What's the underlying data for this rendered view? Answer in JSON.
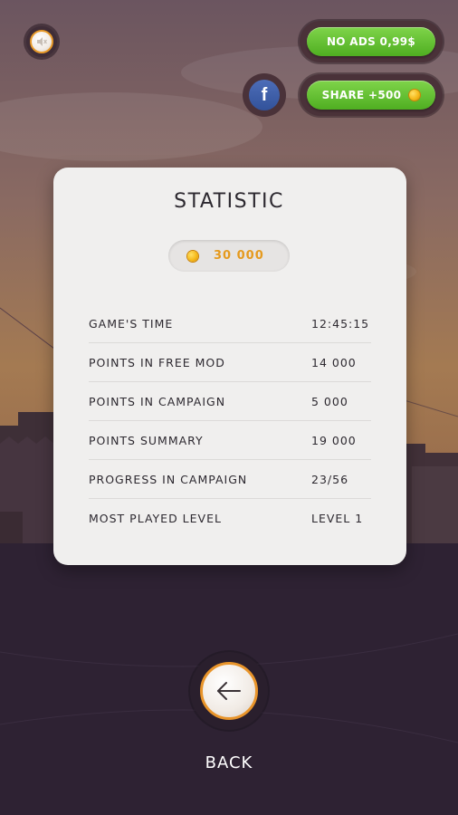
{
  "header": {
    "no_ads_label": "NO ADS 0,99$",
    "share_label": "SHARE +500",
    "facebook_glyph": "f"
  },
  "statistic": {
    "title": "STATISTIC",
    "coins": "30 000",
    "rows": [
      {
        "label": "GAME'S TIME",
        "value": "12:45:15"
      },
      {
        "label": "POINTS IN FREE MOD",
        "value": "14 000"
      },
      {
        "label": "POINTS IN CAMPAIGN",
        "value": "5 000"
      },
      {
        "label": "POINTS SUMMARY",
        "value": "19 000"
      },
      {
        "label": "PROGRESS IN CAMPAIGN",
        "value": "23/56"
      },
      {
        "label": "MOST PLAYED LEVEL",
        "value": "LEVEL 1"
      }
    ]
  },
  "footer": {
    "back_label": "BACK"
  },
  "colors": {
    "accent_orange": "#e59a1e",
    "button_green": "#5cba2a",
    "card_bg": "#f0efee",
    "facebook_blue": "#3b5ba5"
  },
  "icons": {
    "mute": "speaker-muted-icon",
    "facebook": "facebook-icon",
    "coin": "coin-icon",
    "back": "arrow-left-icon"
  }
}
